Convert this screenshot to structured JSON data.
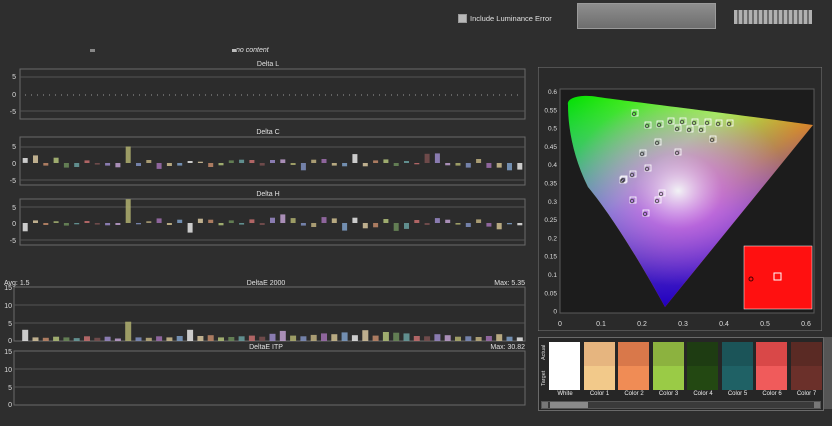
{
  "toolbar": {
    "luminance_label": "Include Luminance Error",
    "luminance_checked": false,
    "no_content_label": "no content"
  },
  "charts": {
    "delta_l": {
      "title": "Delta L",
      "ticks": [
        "5",
        "0",
        "-5"
      ]
    },
    "delta_c": {
      "title": "Delta C",
      "ticks": [
        "5",
        "0",
        "-5"
      ]
    },
    "delta_h": {
      "title": "Delta H",
      "ticks": [
        "5",
        "0",
        "-5"
      ]
    },
    "de2000": {
      "title": "DeltaE 2000",
      "avg": "Avg: 1.5",
      "max": "Max: 5.35",
      "ticks": [
        "15",
        "10",
        "5",
        "0"
      ]
    },
    "itp": {
      "title": "DeltaE ITP",
      "max": "Max: 30.82",
      "ticks": [
        "15",
        "10",
        "5",
        "0"
      ]
    }
  },
  "chart_data": [
    {
      "type": "bar",
      "title": "Delta C",
      "ylim": [
        -5,
        5
      ],
      "values": [
        1.5,
        2.3,
        -0.8,
        1.6,
        -1.4,
        -1.2,
        0.8,
        -0.5,
        -0.8,
        -1.3,
        5.0,
        -0.9,
        0.9,
        -1.8,
        -0.9,
        -0.8,
        0.6,
        0.4,
        -1.2,
        -0.7,
        0.8,
        1.0,
        0.9,
        -0.8,
        0.9,
        1.1,
        -0.6,
        -2.2,
        1.0,
        1.2,
        -0.8,
        -1.0,
        2.7,
        -1.0,
        0.8,
        1.1,
        -0.9,
        0.6,
        -0.4,
        2.8,
        2.9,
        -0.7,
        -0.8,
        -1.4,
        1.2,
        -1.5,
        -1.4,
        -2.2,
        -2.0
      ]
    },
    {
      "type": "bar",
      "title": "Delta H",
      "ylim": [
        -5,
        5
      ],
      "values": [
        -2.5,
        0.8,
        -0.6,
        0.5,
        -0.8,
        -0.4,
        0.6,
        -0.5,
        -0.7,
        -0.6,
        7.2,
        -0.4,
        0.5,
        1.4,
        -0.6,
        1.0,
        -2.9,
        1.3,
        1.0,
        -0.7,
        0.8,
        -0.5,
        1.1,
        -0.6,
        1.6,
        2.6,
        1.5,
        -0.8,
        -1.2,
        1.8,
        1.4,
        -2.3,
        1.6,
        -1.6,
        -1.3,
        1.2,
        -2.4,
        -1.8,
        0.9,
        -0.6,
        1.5,
        1.0,
        -0.5,
        -1.2,
        1.1,
        -1.1,
        -1.9,
        -0.4,
        -0.7
      ]
    },
    {
      "type": "bar",
      "title": "DeltaE 2000",
      "ylim": [
        0,
        15
      ],
      "values": [
        3.1,
        1.0,
        0.9,
        1.2,
        1.0,
        0.8,
        1.3,
        0.9,
        1.2,
        0.7,
        5.35,
        1.0,
        0.9,
        1.3,
        1.0,
        1.4,
        3.1,
        1.4,
        1.6,
        1.0,
        1.1,
        1.3,
        1.5,
        1.2,
        2.0,
        2.8,
        1.5,
        1.3,
        1.7,
        2.1,
        1.9,
        2.4,
        1.6,
        3.0,
        1.5,
        2.5,
        2.3,
        2.1,
        1.4,
        1.3,
        1.9,
        1.6,
        1.2,
        1.3,
        1.1,
        1.4,
        1.9,
        1.2,
        1.0
      ]
    }
  ],
  "swatches": {
    "row_actual": "Actual",
    "row_target": "Target",
    "items": [
      {
        "label": "White",
        "actual": "#ffffff",
        "target": "#ffffff"
      },
      {
        "label": "Color 1",
        "actual": "#e6b57f",
        "target": "#f2c98a"
      },
      {
        "label": "Color 2",
        "actual": "#d9784a",
        "target": "#f08c55"
      },
      {
        "label": "Color 3",
        "actual": "#8cb23f",
        "target": "#9acb46"
      },
      {
        "label": "Color 4",
        "actual": "#1e3c12",
        "target": "#234812"
      },
      {
        "label": "Color 5",
        "actual": "#1b5458",
        "target": "#1f6165"
      },
      {
        "label": "Color 6",
        "actual": "#d94848",
        "target": "#f05b5b"
      },
      {
        "label": "Color 7",
        "actual": "#5a2a24",
        "target": "#6b302a"
      }
    ]
  },
  "gamut": {
    "x_ticks": [
      "0",
      "0.1",
      "0.2",
      "0.3",
      "0.4",
      "0.5",
      "0.6"
    ],
    "y_ticks": [
      "0.6",
      "0.55",
      "0.5",
      "0.45",
      "0.4",
      "0.35",
      "0.3",
      "0.25",
      "0.2",
      "0.15",
      "0.1",
      "0.05",
      "0"
    ]
  }
}
